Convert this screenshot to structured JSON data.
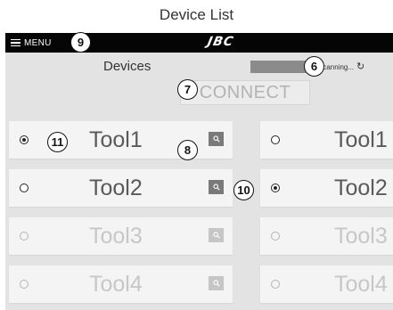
{
  "document_title": "Device List",
  "topbar": {
    "menu_label": "MENU",
    "logo_text": "JBC"
  },
  "screen": {
    "heading": "Devices",
    "scan_status": "Scanning...",
    "connect_label": "CONNECT"
  },
  "left_column": [
    {
      "label": "Tool1",
      "selected": true,
      "active": true
    },
    {
      "label": "Tool2",
      "selected": false,
      "active": true
    },
    {
      "label": "Tool3",
      "selected": false,
      "active": false
    },
    {
      "label": "Tool4",
      "selected": false,
      "active": false
    }
  ],
  "right_column": [
    {
      "label": "Tool1",
      "selected": false,
      "active": true
    },
    {
      "label": "Tool2",
      "selected": true,
      "active": true
    },
    {
      "label": "Tool3",
      "selected": false,
      "active": false
    },
    {
      "label": "Tool4",
      "selected": false,
      "active": false
    }
  ],
  "callouts": [
    "6",
    "7",
    "8",
    "9",
    "10",
    "11"
  ],
  "icons": {
    "menu": "hamburger-icon",
    "refresh": "refresh-icon",
    "search": "search-icon"
  },
  "colors": {
    "topbar": "#050505",
    "screen_bg": "#e3e3e3",
    "card_bg": "#f4f4f4",
    "scan_bar": "#8b8b8b",
    "search_active": "#7a7a7a",
    "search_faded": "#c6c6c6",
    "text_dim": "#c7c7c7"
  }
}
